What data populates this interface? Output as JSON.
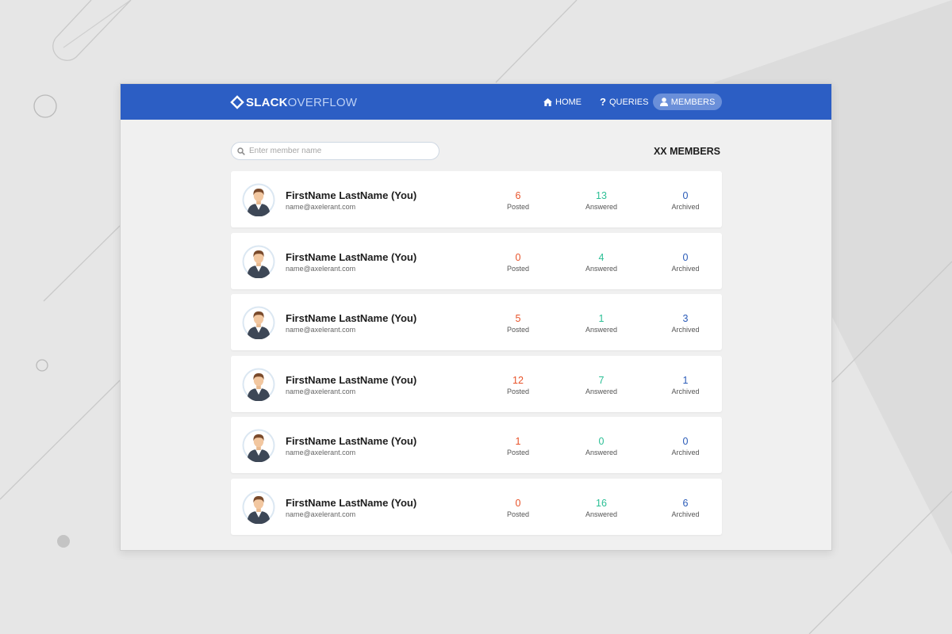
{
  "app": {
    "logo_bold": "SLACK",
    "logo_light": "OVERFLOW"
  },
  "nav": {
    "home": "HOME",
    "queries": "QUERIES",
    "members": "MEMBERS",
    "active": "members"
  },
  "search": {
    "placeholder": "Enter member name",
    "value": ""
  },
  "members_count": "XX MEMBERS",
  "stat_labels": {
    "posted": "Posted",
    "answered": "Answered",
    "archived": "Archived"
  },
  "members": [
    {
      "name": "FirstName LastName (You)",
      "email": "name@axelerant.com",
      "posted": "6",
      "answered": "13",
      "archived": "0"
    },
    {
      "name": "FirstName LastName (You)",
      "email": "name@axelerant.com",
      "posted": "0",
      "answered": "4",
      "archived": "0"
    },
    {
      "name": "FirstName LastName (You)",
      "email": "name@axelerant.com",
      "posted": "5",
      "answered": "1",
      "archived": "3"
    },
    {
      "name": "FirstName LastName (You)",
      "email": "name@axelerant.com",
      "posted": "12",
      "answered": "7",
      "archived": "1"
    },
    {
      "name": "FirstName LastName (You)",
      "email": "name@axelerant.com",
      "posted": "1",
      "answered": "0",
      "archived": "0"
    },
    {
      "name": "FirstName LastName (You)",
      "email": "name@axelerant.com",
      "posted": "0",
      "answered": "16",
      "archived": "6"
    }
  ],
  "colors": {
    "topbar": "#2c5ec4",
    "nav_active": "#6a8fd9",
    "posted": "#e8532a",
    "answered": "#2bbf95",
    "archived": "#2a5bb8"
  },
  "icons": {
    "logo": "diamond-logo-icon",
    "home": "home-icon",
    "queries": "question-icon",
    "members": "user-icon",
    "search": "search-icon",
    "avatar": "avatar-icon"
  }
}
